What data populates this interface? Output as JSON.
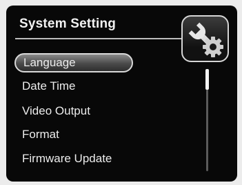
{
  "window": {
    "title": "System Setting",
    "icon": "wrench-gear-icon"
  },
  "menu": {
    "items": [
      {
        "label": "Language",
        "selected": true
      },
      {
        "label": "Date Time",
        "selected": false
      },
      {
        "label": "Video Output",
        "selected": false
      },
      {
        "label": "Format",
        "selected": false
      },
      {
        "label": "Firmware Update",
        "selected": false
      }
    ]
  },
  "colors": {
    "background": "#080808",
    "text": "#ececec",
    "highlight": "#6a6a6a"
  }
}
